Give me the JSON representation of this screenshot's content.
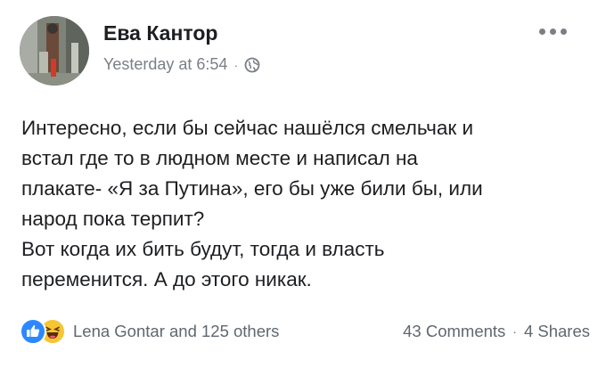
{
  "post": {
    "author": "Ева Кантор",
    "timestamp": "Yesterday at 6:54",
    "separator": "·",
    "privacy_icon": "globe-icon",
    "more_icon": "more-options-icon",
    "text_lines": [
      "Интересно, если бы сейчас нашёлся смельчак и",
      "встал где то в людном месте и написал на",
      "плакате- «Я за Путина», его бы уже били бы, или",
      "народ пока терпит?",
      "Вот когда их бить будут, тогда и власть",
      "переменится. А до этого никак."
    ]
  },
  "footer": {
    "reaction_icons": [
      "like-icon",
      "haha-icon"
    ],
    "reactions_text": "Lena Gontar and 125 others",
    "comments": "43 Comments",
    "separator": "·",
    "shares": "4 Shares"
  },
  "colors": {
    "text": "#1c1e21",
    "meta": "#7a7f87",
    "like_blue": "#2d88ff",
    "haha_yellow": "#f7c531"
  }
}
